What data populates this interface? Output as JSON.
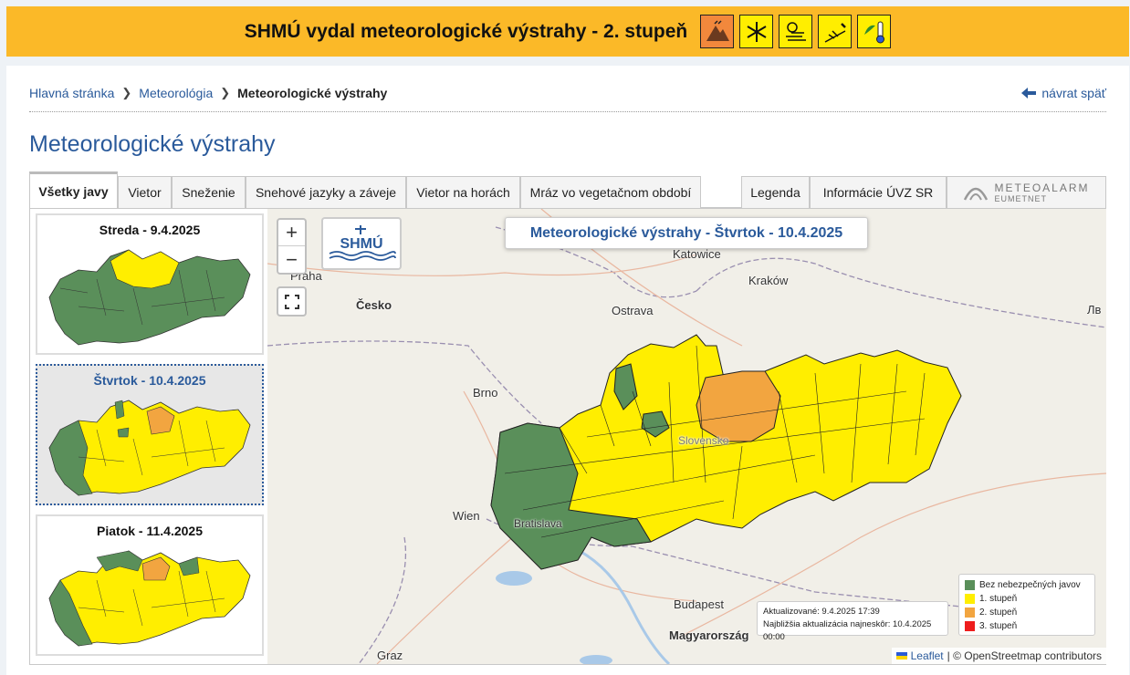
{
  "banner": {
    "text": "SHMÚ vydal meteorologické výstrahy - 2. stupeň",
    "icons": [
      {
        "name": "mountain-wind-icon",
        "color": "#f2883c"
      },
      {
        "name": "snowflake-icon",
        "color": "#ffee00"
      },
      {
        "name": "snow-wind-icon",
        "color": "#ffee00"
      },
      {
        "name": "plant-frost-icon",
        "color": "#ffee00"
      },
      {
        "name": "uv-thermometer-icon",
        "color": "#ffee00"
      }
    ]
  },
  "breadcrumb": {
    "home": "Hlavná stránka",
    "section": "Meteorológia",
    "current": "Meteorologické výstrahy"
  },
  "back_link": "návrat späť",
  "page_title": "Meteorologické výstrahy",
  "tabs": {
    "all": "Všetky javy",
    "wind": "Vietor",
    "snow": "Sneženie",
    "snow_drifts": "Snehové jazyky a záveje",
    "mountain_wind": "Vietor na horách",
    "frost": "Mráz vo vegetačnom období",
    "legend": "Legenda",
    "uvz": "Informácie ÚVZ SR",
    "meteoalarm": "METEOALARM",
    "eumetnet": "EUMETNET"
  },
  "days": [
    {
      "label": "Streda - 9.4.2025"
    },
    {
      "label": "Štvrtok - 10.4.2025"
    },
    {
      "label": "Piatok - 11.4.2025"
    }
  ],
  "map": {
    "title": "Meteorologické výstrahy - Štvrtok - 10.4.2025",
    "zoom_in": "+",
    "zoom_out": "−",
    "logo_text": "SHMÚ",
    "cities": {
      "praha": "Praha",
      "cesko": "Česko",
      "katowice": "Katowice",
      "krakow": "Kraków",
      "ostrava": "Ostrava",
      "brno": "Brno",
      "wien": "Wien",
      "bratislava": "Bratislava",
      "slovensko": "Slovensko",
      "budapest": "Budapest",
      "magyarorszag": "Magyarország",
      "graz": "Graz",
      "lv": "Лв"
    },
    "update": {
      "updated": "Aktualizované: 9.4.2025 17:39",
      "next": "Najbližšia aktualizácia najneskôr: 10.4.2025 00:00"
    },
    "legend": [
      {
        "label": "Bez nebezpečných javov",
        "color": "#5a8f5a"
      },
      {
        "label": "1. stupeň",
        "color": "#ffee00"
      },
      {
        "label": "2. stupeň",
        "color": "#f2a540"
      },
      {
        "label": "3. stupeň",
        "color": "#ee1d1d"
      }
    ],
    "attribution_leaflet": "Leaflet",
    "attribution_rest": "| © OpenStreetmap contributors"
  }
}
